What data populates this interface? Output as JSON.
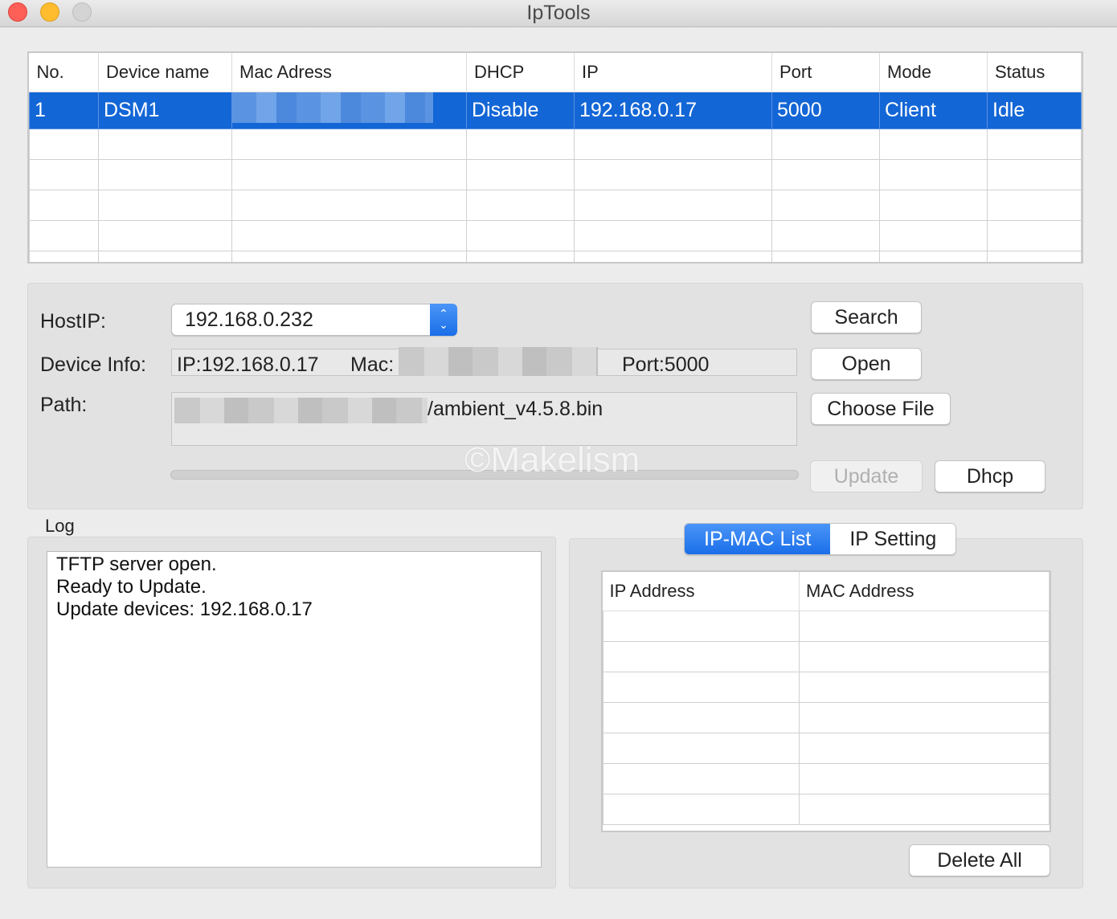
{
  "window": {
    "title": "IpTools"
  },
  "device_table": {
    "columns": [
      "No.",
      "Device name",
      "Mac Adress",
      "DHCP",
      "IP",
      "Port",
      "Mode",
      "Status"
    ],
    "rows": [
      {
        "no": "1",
        "device_name": "DSM1",
        "mac": "",
        "dhcp": "Disable",
        "ip": "192.168.0.17",
        "port": "5000",
        "mode": "Client",
        "status": "Idle"
      }
    ]
  },
  "settings": {
    "host_ip_label": "HostIP:",
    "host_ip_value": "192.168.0.232",
    "device_info_label": "Device Info:",
    "device_info_ip": "IP:192.168.0.17",
    "device_info_mac_label": "Mac:",
    "device_info_port": "Port:5000",
    "path_label": "Path:",
    "path_value_suffix": "/ambient_v4.5.8.bin",
    "watermark": "©Makelism"
  },
  "buttons": {
    "search": "Search",
    "open": "Open",
    "choose_file": "Choose File",
    "update": "Update",
    "dhcp": "Dhcp",
    "delete_all": "Delete All"
  },
  "log": {
    "label": "Log",
    "lines": [
      "TFTP server open.",
      "Ready to Update.",
      "Update devices: 192.168.0.17"
    ]
  },
  "tabs": {
    "items": [
      "IP-MAC List",
      "IP Setting"
    ],
    "active": "IP-MAC List"
  },
  "ip_mac_table": {
    "columns": [
      "IP Address",
      "MAC Address"
    ]
  },
  "colors": {
    "selection": "#1366d6",
    "accent": "#1a6ee8"
  }
}
